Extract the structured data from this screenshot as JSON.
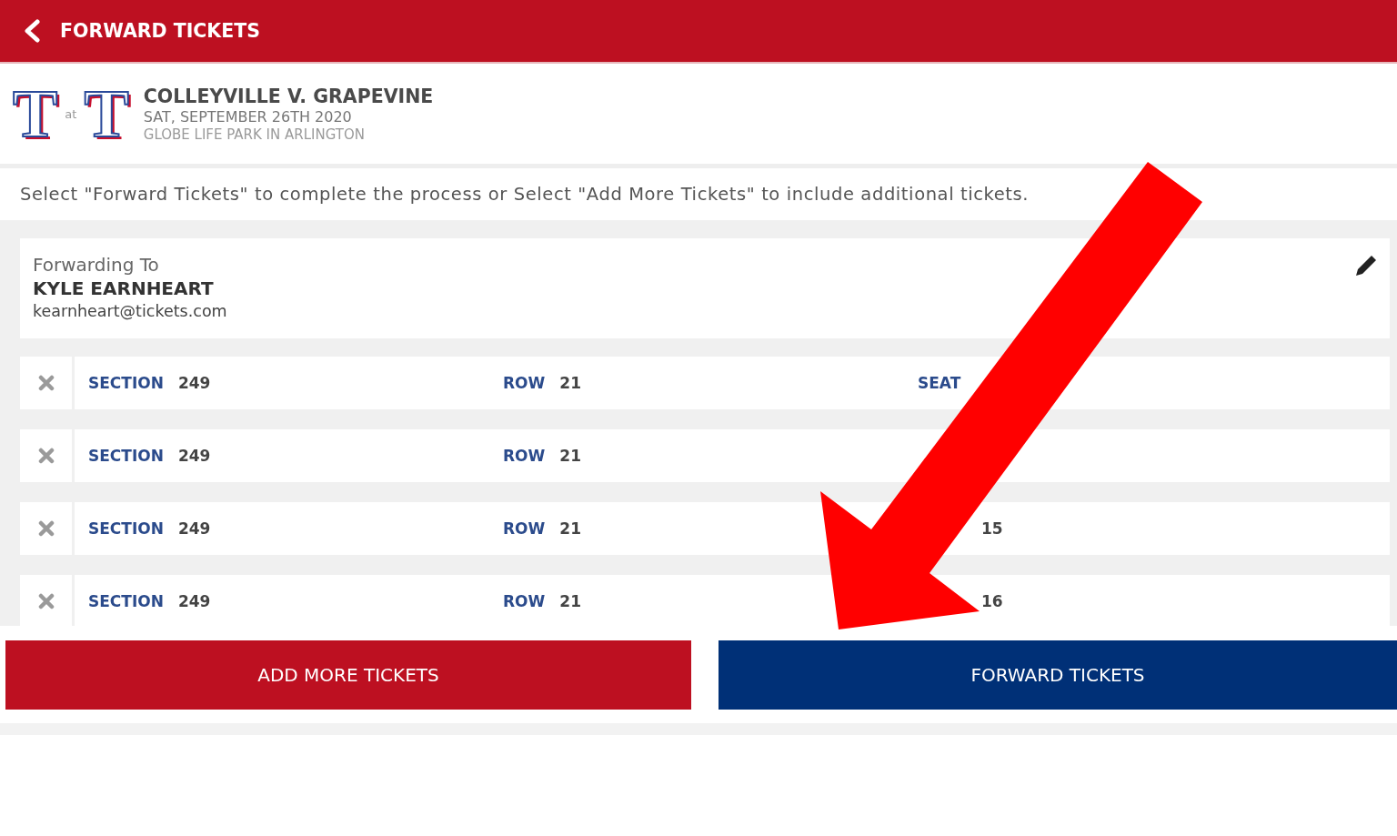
{
  "header": {
    "title": "FORWARD TICKETS"
  },
  "game": {
    "logos": [
      {
        "letter": "T"
      },
      {
        "letter": "T"
      }
    ],
    "separator": "at",
    "title": "COLLEYVILLE V. GRAPEVINE",
    "date": "SAT, SEPTEMBER 26TH 2020",
    "venue": "GLOBE LIFE PARK IN ARLINGTON"
  },
  "instruction": "Select \"Forward Tickets\" to complete the process or Select \"Add More Tickets\" to include additional tickets.",
  "recipient": {
    "label": "Forwarding To",
    "name": "KYLE EARNHEART",
    "email": "kearnheart@tickets.com"
  },
  "tickets": [
    {
      "section_label": "SECTION",
      "section": "249",
      "row_label": "ROW",
      "row": "21",
      "seat_label": "SEAT"
    },
    {
      "section_label": "SECTION",
      "section": "249",
      "row_label": "ROW",
      "row": "21"
    },
    {
      "section_label": "SECTION",
      "section": "249",
      "row_label": "ROW",
      "row": "21",
      "seat": "15"
    },
    {
      "section_label": "SECTION",
      "section": "249",
      "row_label": "ROW",
      "row": "21",
      "seat": "16"
    }
  ],
  "buttons": [
    {
      "label": "ADD MORE TICKETS",
      "kind": "secondary"
    },
    {
      "label": "FORWARD TICKETS",
      "kind": "primary"
    }
  ]
}
